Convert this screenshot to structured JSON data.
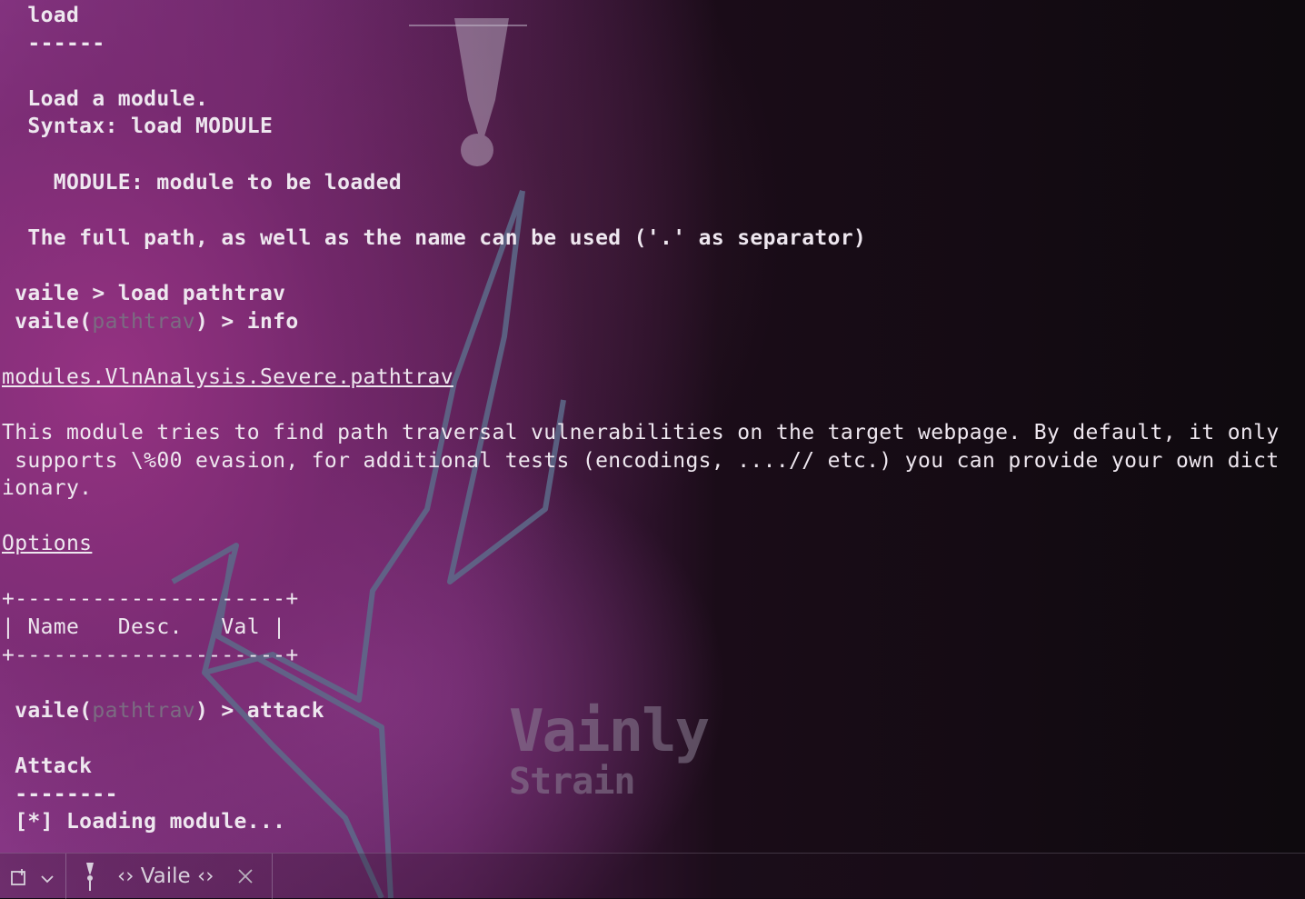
{
  "terminal": {
    "lines": [
      [
        {
          "t": "  load",
          "c": "b"
        }
      ],
      [
        {
          "t": "  ------",
          "c": "b"
        }
      ],
      [
        {
          "t": ""
        }
      ],
      [
        {
          "t": "  Load a module.",
          "c": "b"
        }
      ],
      [
        {
          "t": "  Syntax: load MODULE",
          "c": "b"
        }
      ],
      [
        {
          "t": ""
        }
      ],
      [
        {
          "t": "    MODULE: module to be loaded",
          "c": "b"
        }
      ],
      [
        {
          "t": ""
        }
      ],
      [
        {
          "t": "  The full path, as well as the name can be used ('.' as separator)",
          "c": "b"
        }
      ],
      [
        {
          "t": ""
        }
      ],
      [
        {
          "t": " vaile > load pathtrav",
          "c": "b"
        }
      ],
      [
        {
          "t": " vaile(",
          "c": "b"
        },
        {
          "t": "pathtrav",
          "c": "dim"
        },
        {
          "t": ") > info",
          "c": "b"
        }
      ],
      [
        {
          "t": ""
        }
      ],
      [
        {
          "t": "modules.VlnAnalysis.Severe.pathtrav",
          "c": "u"
        }
      ],
      [
        {
          "t": ""
        }
      ],
      [
        {
          "t": "This module tries to find path traversal vulnerabilities on the target webpage. By default, it only"
        }
      ],
      [
        {
          "t": " supports \\%00 evasion, for additional tests (encodings, ....// etc.) you can provide your own dict"
        }
      ],
      [
        {
          "t": "ionary."
        }
      ],
      [
        {
          "t": ""
        }
      ],
      [
        {
          "t": "Options",
          "c": "u"
        }
      ],
      [
        {
          "t": ""
        }
      ],
      [
        {
          "t": "+---------------------+"
        }
      ],
      [
        {
          "t": "| Name   Desc.   Val |"
        }
      ],
      [
        {
          "t": "+---------------------+"
        }
      ],
      [
        {
          "t": ""
        }
      ],
      [
        {
          "t": " vaile(",
          "c": "b"
        },
        {
          "t": "pathtrav",
          "c": "dim"
        },
        {
          "t": ") > attack",
          "c": "b"
        }
      ],
      [
        {
          "t": ""
        }
      ],
      [
        {
          "t": " Attack",
          "c": "b"
        }
      ],
      [
        {
          "t": " --------",
          "c": "b"
        }
      ],
      [
        {
          "t": " [*] Loading module...",
          "c": "b"
        }
      ]
    ]
  },
  "wallpaper": {
    "line1": "Vainly",
    "line2": "Strain"
  },
  "tabbar": {
    "tab_title": "‹› Vaile ‹›",
    "icons": {
      "new_tab": "new-tab-icon",
      "menu": "chevron-down-icon",
      "app": "vaile-figure-icon",
      "close": "close-icon"
    }
  },
  "colors": {
    "text": "#eee7ef",
    "dim_text": "#7b6c82",
    "background": "#0d0810",
    "wallpaper_purple": "#8a3a8a"
  }
}
